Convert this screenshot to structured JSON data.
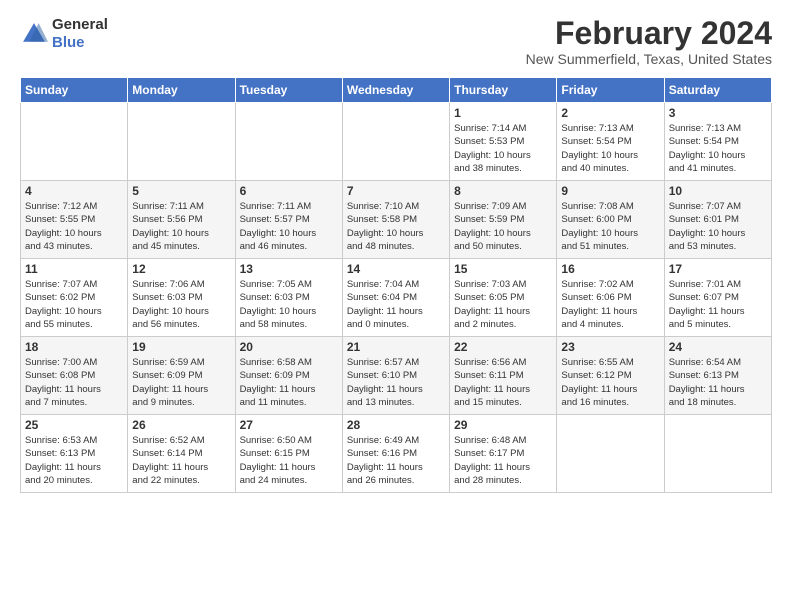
{
  "logo": {
    "general": "General",
    "blue": "Blue"
  },
  "title": "February 2024",
  "subtitle": "New Summerfield, Texas, United States",
  "headers": [
    "Sunday",
    "Monday",
    "Tuesday",
    "Wednesday",
    "Thursday",
    "Friday",
    "Saturday"
  ],
  "weeks": [
    [
      {
        "day": "",
        "info": ""
      },
      {
        "day": "",
        "info": ""
      },
      {
        "day": "",
        "info": ""
      },
      {
        "day": "",
        "info": ""
      },
      {
        "day": "1",
        "info": "Sunrise: 7:14 AM\nSunset: 5:53 PM\nDaylight: 10 hours\nand 38 minutes."
      },
      {
        "day": "2",
        "info": "Sunrise: 7:13 AM\nSunset: 5:54 PM\nDaylight: 10 hours\nand 40 minutes."
      },
      {
        "day": "3",
        "info": "Sunrise: 7:13 AM\nSunset: 5:54 PM\nDaylight: 10 hours\nand 41 minutes."
      }
    ],
    [
      {
        "day": "4",
        "info": "Sunrise: 7:12 AM\nSunset: 5:55 PM\nDaylight: 10 hours\nand 43 minutes."
      },
      {
        "day": "5",
        "info": "Sunrise: 7:11 AM\nSunset: 5:56 PM\nDaylight: 10 hours\nand 45 minutes."
      },
      {
        "day": "6",
        "info": "Sunrise: 7:11 AM\nSunset: 5:57 PM\nDaylight: 10 hours\nand 46 minutes."
      },
      {
        "day": "7",
        "info": "Sunrise: 7:10 AM\nSunset: 5:58 PM\nDaylight: 10 hours\nand 48 minutes."
      },
      {
        "day": "8",
        "info": "Sunrise: 7:09 AM\nSunset: 5:59 PM\nDaylight: 10 hours\nand 50 minutes."
      },
      {
        "day": "9",
        "info": "Sunrise: 7:08 AM\nSunset: 6:00 PM\nDaylight: 10 hours\nand 51 minutes."
      },
      {
        "day": "10",
        "info": "Sunrise: 7:07 AM\nSunset: 6:01 PM\nDaylight: 10 hours\nand 53 minutes."
      }
    ],
    [
      {
        "day": "11",
        "info": "Sunrise: 7:07 AM\nSunset: 6:02 PM\nDaylight: 10 hours\nand 55 minutes."
      },
      {
        "day": "12",
        "info": "Sunrise: 7:06 AM\nSunset: 6:03 PM\nDaylight: 10 hours\nand 56 minutes."
      },
      {
        "day": "13",
        "info": "Sunrise: 7:05 AM\nSunset: 6:03 PM\nDaylight: 10 hours\nand 58 minutes."
      },
      {
        "day": "14",
        "info": "Sunrise: 7:04 AM\nSunset: 6:04 PM\nDaylight: 11 hours\nand 0 minutes."
      },
      {
        "day": "15",
        "info": "Sunrise: 7:03 AM\nSunset: 6:05 PM\nDaylight: 11 hours\nand 2 minutes."
      },
      {
        "day": "16",
        "info": "Sunrise: 7:02 AM\nSunset: 6:06 PM\nDaylight: 11 hours\nand 4 minutes."
      },
      {
        "day": "17",
        "info": "Sunrise: 7:01 AM\nSunset: 6:07 PM\nDaylight: 11 hours\nand 5 minutes."
      }
    ],
    [
      {
        "day": "18",
        "info": "Sunrise: 7:00 AM\nSunset: 6:08 PM\nDaylight: 11 hours\nand 7 minutes."
      },
      {
        "day": "19",
        "info": "Sunrise: 6:59 AM\nSunset: 6:09 PM\nDaylight: 11 hours\nand 9 minutes."
      },
      {
        "day": "20",
        "info": "Sunrise: 6:58 AM\nSunset: 6:09 PM\nDaylight: 11 hours\nand 11 minutes."
      },
      {
        "day": "21",
        "info": "Sunrise: 6:57 AM\nSunset: 6:10 PM\nDaylight: 11 hours\nand 13 minutes."
      },
      {
        "day": "22",
        "info": "Sunrise: 6:56 AM\nSunset: 6:11 PM\nDaylight: 11 hours\nand 15 minutes."
      },
      {
        "day": "23",
        "info": "Sunrise: 6:55 AM\nSunset: 6:12 PM\nDaylight: 11 hours\nand 16 minutes."
      },
      {
        "day": "24",
        "info": "Sunrise: 6:54 AM\nSunset: 6:13 PM\nDaylight: 11 hours\nand 18 minutes."
      }
    ],
    [
      {
        "day": "25",
        "info": "Sunrise: 6:53 AM\nSunset: 6:13 PM\nDaylight: 11 hours\nand 20 minutes."
      },
      {
        "day": "26",
        "info": "Sunrise: 6:52 AM\nSunset: 6:14 PM\nDaylight: 11 hours\nand 22 minutes."
      },
      {
        "day": "27",
        "info": "Sunrise: 6:50 AM\nSunset: 6:15 PM\nDaylight: 11 hours\nand 24 minutes."
      },
      {
        "day": "28",
        "info": "Sunrise: 6:49 AM\nSunset: 6:16 PM\nDaylight: 11 hours\nand 26 minutes."
      },
      {
        "day": "29",
        "info": "Sunrise: 6:48 AM\nSunset: 6:17 PM\nDaylight: 11 hours\nand 28 minutes."
      },
      {
        "day": "",
        "info": ""
      },
      {
        "day": "",
        "info": ""
      }
    ]
  ]
}
